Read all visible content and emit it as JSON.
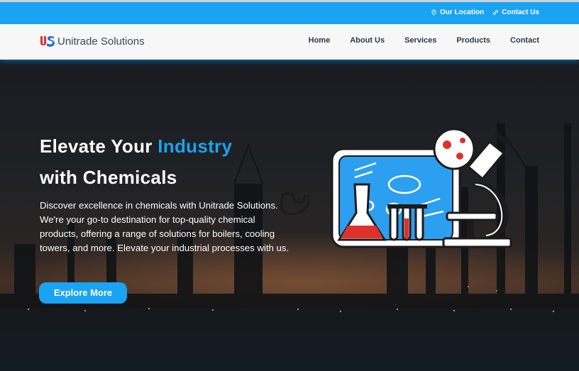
{
  "topbar": {
    "location_label": "Our Location",
    "contact_label": "Contact Us"
  },
  "brand": {
    "logo_text": "US",
    "name": "Unitrade Solutions"
  },
  "nav": {
    "items": [
      "Home",
      "About Us",
      "Services",
      "Products",
      "Contact"
    ]
  },
  "hero": {
    "title_part1": "Elevate Your ",
    "title_accent": "Industry",
    "title_line2": "with Chemicals",
    "description": "Discover excellence in chemicals with Unitrade Solutions. We're your go-to destination for top-quality chemical products, offering a range of solutions for boilers, cooling towers, and more. Elevate your industrial processes with us.",
    "cta_label": "Explore More"
  },
  "colors": {
    "accent": "#1aa3f2",
    "logo_red": "#e0302e",
    "logo_blue": "#1f6fd1",
    "navbar_bg": "#f7f7f7"
  },
  "icons": {
    "location": "map-pin-icon",
    "contact": "link-icon",
    "phone": "phone-icon"
  }
}
